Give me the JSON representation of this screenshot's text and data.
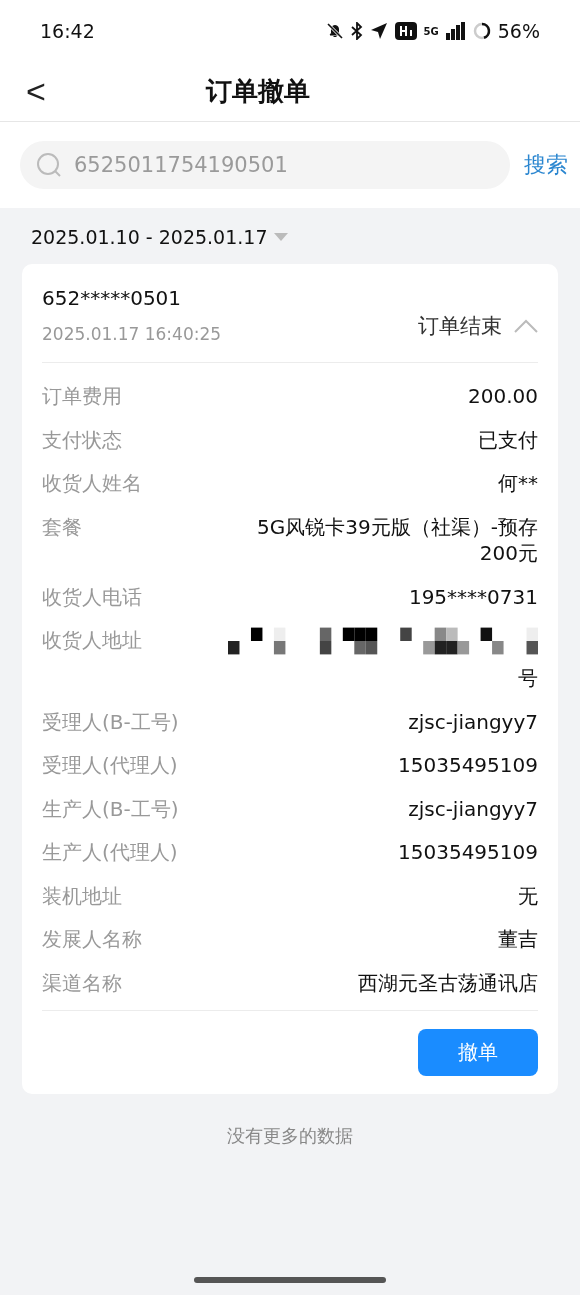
{
  "status_bar": {
    "time": "16:42",
    "network": "5G",
    "battery": "56%"
  },
  "header": {
    "back": "<",
    "title": "订单撤单"
  },
  "search": {
    "value": "6525011754190501",
    "button": "搜索"
  },
  "date_filter": {
    "range": "2025.01.10 - 2025.01.17",
    "expanded": false
  },
  "order": {
    "number": "652*****0501",
    "time": "2025.01.17 16:40:25",
    "status": "订单结束",
    "expanded": true,
    "fields": [
      {
        "kind": "text",
        "label": "订单费用",
        "value": "200.00"
      },
      {
        "kind": "text",
        "label": "支付状态",
        "value": "已支付"
      },
      {
        "kind": "text",
        "label": "收货人姓名",
        "value": "何**"
      },
      {
        "kind": "text",
        "label": "套餐",
        "value": "5G风锐卡39元版（社渠）-预存200元"
      },
      {
        "kind": "text",
        "label": "收货人电话",
        "value": "195****0731"
      },
      {
        "kind": "redacted",
        "label": "收货人地址",
        "value": "号"
      },
      {
        "kind": "text",
        "label": "受理人(B-工号)",
        "value": "zjsc-jiangyy7"
      },
      {
        "kind": "text",
        "label": "受理人(代理人)",
        "value": "15035495109"
      },
      {
        "kind": "text",
        "label": "生产人(B-工号)",
        "value": "zjsc-jiangyy7"
      },
      {
        "kind": "text",
        "label": "生产人(代理人)",
        "value": "15035495109"
      },
      {
        "kind": "text",
        "label": "装机地址",
        "value": "无"
      },
      {
        "kind": "text",
        "label": "发展人名称",
        "value": "董吉"
      },
      {
        "kind": "text",
        "label": "渠道名称",
        "value": "西湖元圣古荡通讯店"
      }
    ],
    "action": "撤单"
  },
  "footer": "没有更多的数据"
}
